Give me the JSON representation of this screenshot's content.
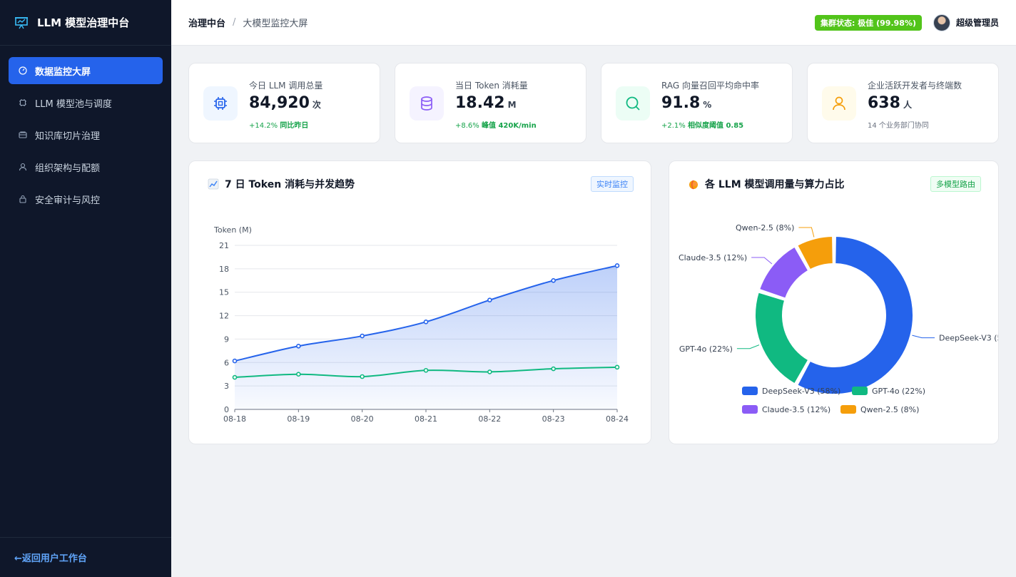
{
  "sidebar": {
    "brand_title": "LLM 模型治理中台",
    "items": [
      {
        "label": "数据监控大屏",
        "icon": "dashboard-icon"
      },
      {
        "label": "LLM 模型池与调度",
        "icon": "chip-icon"
      },
      {
        "label": "知识库切片治理",
        "icon": "folder-icon"
      },
      {
        "label": "组织架构与配额",
        "icon": "user-icon"
      },
      {
        "label": "安全审计与风控",
        "icon": "lock-icon"
      }
    ],
    "back_link": "←返回用户工作台"
  },
  "header": {
    "breadcrumb_root": "治理中台",
    "breadcrumb_sep": "/",
    "breadcrumb_current": "大模型监控大屏",
    "status_badge": "集群状态: 极佳 (99.98%)",
    "user_name": "超级管理员"
  },
  "stats": [
    {
      "label": "今日 LLM 调用总量",
      "value": "84,920",
      "unit": "次",
      "sub_pct": "+14.2%",
      "sub_desc": "同比昨日",
      "icon": "chip-icon",
      "color": "#2563eb",
      "bg": "#eff6ff"
    },
    {
      "label": "当日 Token 消耗量",
      "value": "18.42",
      "unit": "M",
      "sub_pct": "+8.6%",
      "sub_desc": "峰值 420K/min",
      "icon": "database-icon",
      "color": "#8b5cf6",
      "bg": "#f5f3ff"
    },
    {
      "label": "RAG 向量召回平均命中率",
      "value": "91.8",
      "unit": "%",
      "sub_pct": "+2.1%",
      "sub_desc": "相似度阈值 0.85",
      "icon": "search-icon",
      "color": "#10b981",
      "bg": "#ecfdf5"
    },
    {
      "label": "企业活跃开发者与终端数",
      "value": "638",
      "unit": "人",
      "sub_text": "14 个业务部门协同",
      "icon": "user-icon",
      "color": "#f59e0b",
      "bg": "#fffbeb"
    }
  ],
  "trend_card": {
    "title": "7 日 Token 消耗与并发趋势",
    "tag": "实时监控"
  },
  "pie_card": {
    "title": "各 LLM 模型调用量与算力占比",
    "tag": "多模型路由"
  },
  "chart_data": [
    {
      "type": "area",
      "ylabel": "Token (M)",
      "x": [
        "08-18",
        "08-19",
        "08-20",
        "08-21",
        "08-22",
        "08-23",
        "08-24"
      ],
      "ylim": [
        0,
        21
      ],
      "yticks": [
        0,
        3,
        6,
        9,
        12,
        15,
        18,
        21
      ],
      "grid": true,
      "series": [
        {
          "values": [
            6.2,
            8.1,
            9.4,
            11.2,
            14.0,
            16.5,
            18.4
          ],
          "color": "#2563eb",
          "filled": true
        },
        {
          "values": [
            4.1,
            4.5,
            4.2,
            5.0,
            4.8,
            5.2,
            5.4
          ],
          "color": "#10b981",
          "filled": false
        }
      ]
    },
    {
      "type": "pie",
      "legend": "bottom",
      "categories": [
        "DeepSeek-V3 (58%)",
        "GPT-4o (22%)",
        "Claude-3.5 (12%)",
        "Qwen-2.5 (8%)"
      ],
      "values": [
        58,
        22,
        12,
        8
      ],
      "colors": [
        "#2563eb",
        "#10b981",
        "#8b5cf6",
        "#f59e0b"
      ]
    }
  ]
}
